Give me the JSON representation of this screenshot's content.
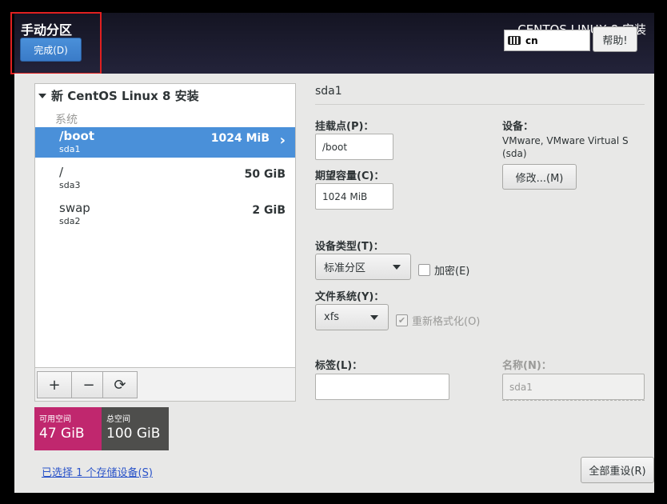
{
  "header": {
    "page_title": "手动分区",
    "done_label": "完成(D)",
    "product_title": "CENTOS LINUX 8 安装",
    "keyboard_layout": "cn",
    "help_label": "帮助!"
  },
  "tree": {
    "header": "新 CentOS Linux 8 安装",
    "group": "系统",
    "partitions": [
      {
        "mount": "/boot",
        "device": "sda1",
        "size": "1024 MiB"
      },
      {
        "mount": "/",
        "device": "sda3",
        "size": "50 GiB"
      },
      {
        "mount": "swap",
        "device": "sda2",
        "size": "2 GiB"
      }
    ],
    "tools": {
      "add": "+",
      "remove": "−",
      "refresh": "⟳"
    }
  },
  "space": {
    "available_label": "可用空间",
    "available_value": "47 GiB",
    "total_label": "总空间",
    "total_value": "100 GiB",
    "available_color": "#c0276e",
    "total_color": "#4e4e4c"
  },
  "storage_link": "已选择 1 个存储设备(S)",
  "detail": {
    "title": "sda1",
    "mount_label": "挂载点(P)：",
    "mount_value": "/boot",
    "capacity_label": "期望容量(C)：",
    "capacity_value": "1024 MiB",
    "device_label": "设备：",
    "device_line1": "VMware, VMware Virtual S",
    "device_line2": "(sda)",
    "modify_label": "修改...(M)",
    "device_type_label": "设备类型(T)：",
    "device_type_value": "标准分区",
    "encrypt_label": "加密(E)",
    "fs_label": "文件系统(Y)：",
    "fs_value": "xfs",
    "reformat_label": "重新格式化(O)",
    "tag_label": "标签(L)：",
    "tag_value": "",
    "name_label": "名称(N)：",
    "name_value": "sda1",
    "reset_label": "全部重设(R)"
  }
}
